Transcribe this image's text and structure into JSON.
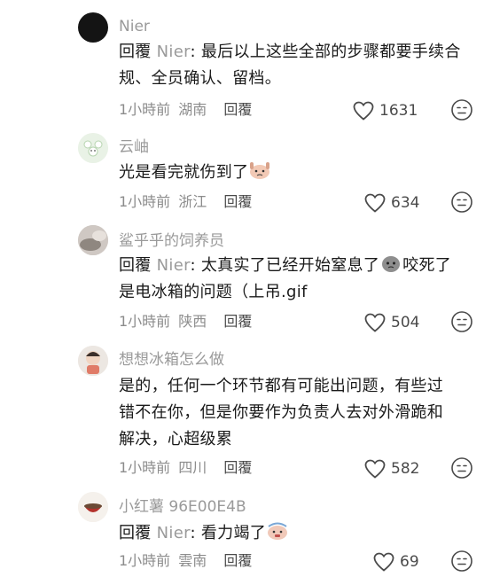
{
  "comments": [
    {
      "username": "Nier",
      "reply_prefix": "回覆",
      "reply_target": "Nier",
      "text_line1": ": 最后以上这些全部的步骤都要手续合",
      "text_line2": "规、全员确认、留档。",
      "time": "1小時前",
      "location": "湖南",
      "reply_label": "回覆",
      "likes": "1631"
    },
    {
      "username": "云岫",
      "text_line1": "光是看完就伤到了",
      "time": "1小時前",
      "location": "浙江",
      "reply_label": "回覆",
      "likes": "634"
    },
    {
      "username": "鲨乎乎的饲养员",
      "reply_prefix": "回覆",
      "reply_target": "Nier",
      "text_line1a": ": 太真实了已经开始窒息了",
      "text_line1b": "咬死了",
      "text_line2": "是电冰箱的问题（上吊.gif",
      "time": "1小時前",
      "location": "陕西",
      "reply_label": "回覆",
      "likes": "504"
    },
    {
      "username": "想想冰箱怎么做",
      "text_line1": "是的，任何一个环节都有可能出问题，有些过",
      "text_line2": "错不在你，但是你要作为负责人去对外滑跪和",
      "text_line3": "解决，心超级累",
      "time": "1小時前",
      "location": "四川",
      "reply_label": "回覆",
      "likes": "582"
    },
    {
      "username": "小红薯 96E00E4B",
      "reply_prefix": "回覆",
      "reply_target": "Nier",
      "text_line1": ": 看力竭了",
      "time": "1小時前",
      "location": "雲南",
      "reply_label": "回覆",
      "likes": "69"
    }
  ],
  "icons": {
    "like": "heart-outline-icon",
    "dislike": "dislike-face-icon"
  }
}
